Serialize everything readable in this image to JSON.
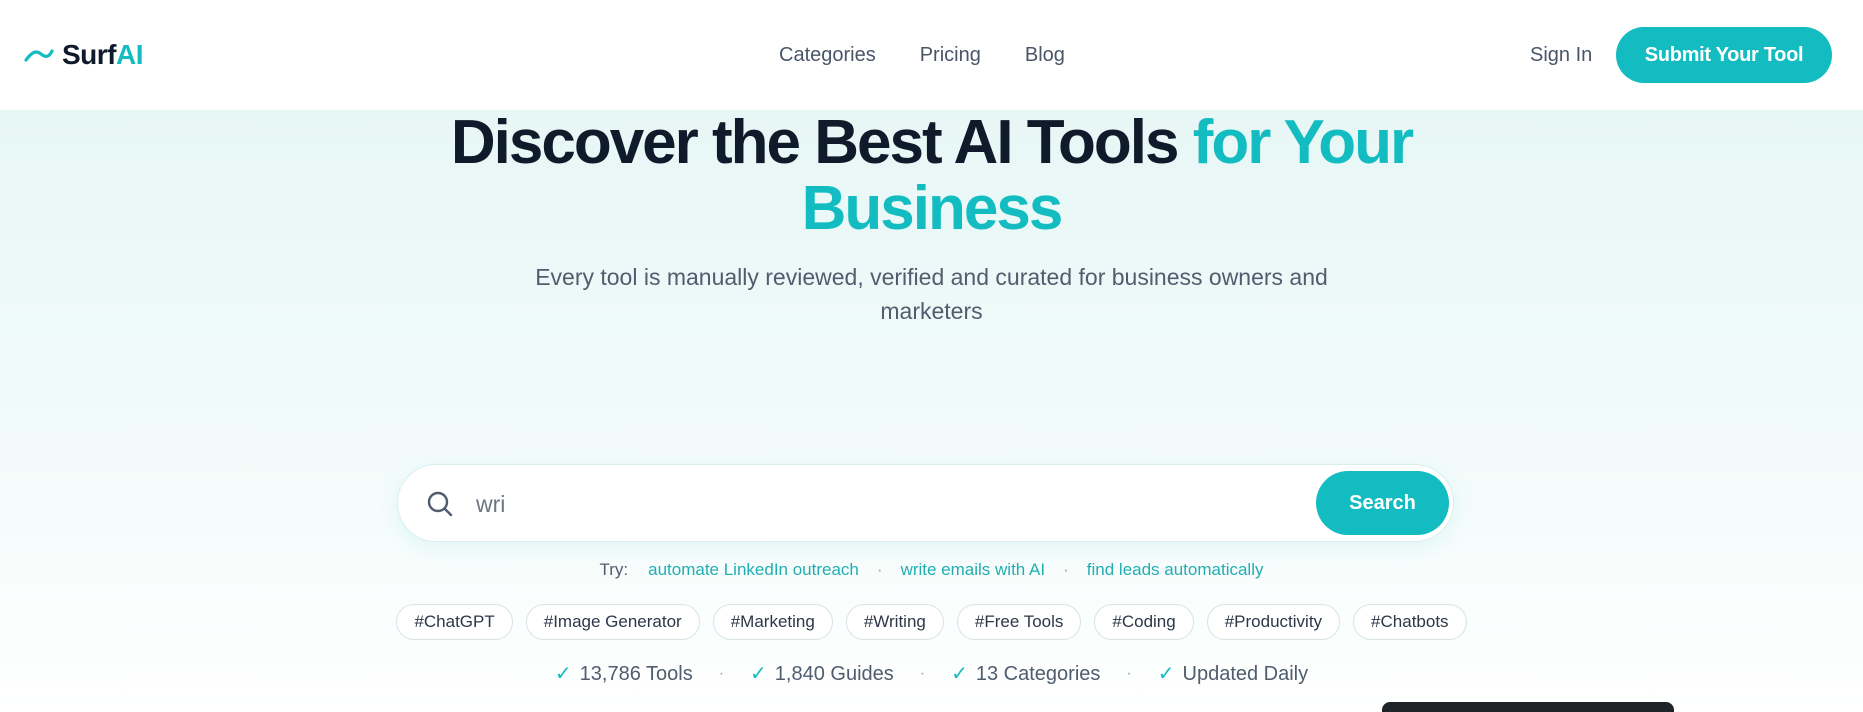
{
  "header": {
    "logo": {
      "text_main": "Surf",
      "text_accent": "AI"
    },
    "nav": [
      "Categories",
      "Pricing",
      "Blog"
    ],
    "sign_in": "Sign In",
    "submit_label": "Submit Your Tool"
  },
  "hero": {
    "headline_dark": "Discover the Best AI Tools",
    "headline_accent_1": "for Your",
    "headline_accent_2": "Business",
    "subtitle": "Every tool is manually reviewed, verified and curated for business owners and marketers"
  },
  "search": {
    "value": "wri",
    "button_label": "Search"
  },
  "try": {
    "label": "Try:",
    "suggestions": [
      "automate LinkedIn outreach",
      "write emails with AI",
      "find leads automatically"
    ]
  },
  "tags": [
    "#ChatGPT",
    "#Image Generator",
    "#Marketing",
    "#Writing",
    "#Free Tools",
    "#Coding",
    "#Productivity",
    "#Chatbots"
  ],
  "stats": [
    "13,786 Tools",
    "1,840 Guides",
    "13 Categories",
    "Updated Daily"
  ],
  "colors": {
    "accent": "#13bcc0",
    "text_dark": "#0f1b2a",
    "text_muted": "#4f5d6e",
    "hero_bg_top": "#e7f7f6"
  },
  "icons": {
    "logo": "wave-icon",
    "search": "search-icon",
    "check": "check-icon"
  }
}
